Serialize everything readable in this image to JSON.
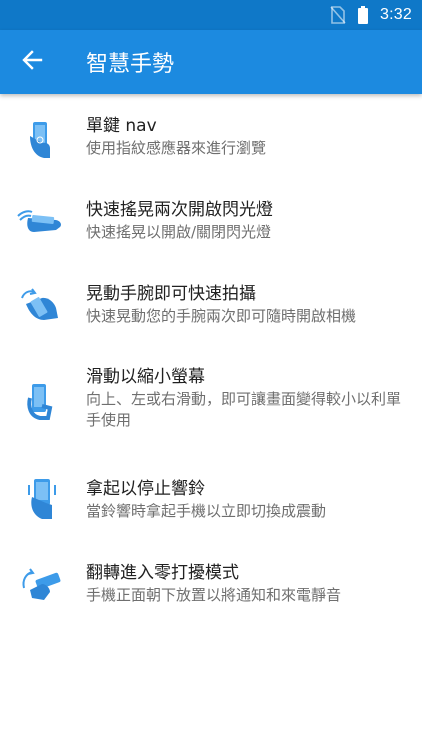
{
  "status_bar": {
    "time": "3:32",
    "icons": [
      "no-sim-icon",
      "battery-icon"
    ]
  },
  "app_bar": {
    "title": "智慧手勢",
    "back_icon": "back-arrow-icon"
  },
  "colors": {
    "primary": "#1c8ae0",
    "primary_dark": "#0f78c8",
    "icon_blue": "#3d9be9"
  },
  "gestures": [
    {
      "title": "單鍵 nav",
      "summary": "使用指紋感應器來進行瀏覽",
      "icon": "fingerprint-phone-icon"
    },
    {
      "title": "快速搖晃兩次開啟閃光燈",
      "summary": "快速搖晃以開啟/關閉閃光燈",
      "icon": "chop-gesture-icon"
    },
    {
      "title": "晃動手腕即可快速拍攝",
      "summary": "快速晃動您的手腕兩次即可隨時開啟相機",
      "icon": "twist-wrist-icon"
    },
    {
      "title": "滑動以縮小螢幕",
      "summary": "向上、左或右滑動，即可讓畫面變得較小以利單手使用",
      "icon": "swipe-shrink-icon"
    },
    {
      "title": "拿起以停止響鈴",
      "summary": "當鈴響時拿起手機以立即切換成震動",
      "icon": "pickup-phone-icon"
    },
    {
      "title": "翻轉進入零打擾模式",
      "summary": "手機正面朝下放置以將通知和來電靜音",
      "icon": "flip-phone-icon"
    }
  ]
}
